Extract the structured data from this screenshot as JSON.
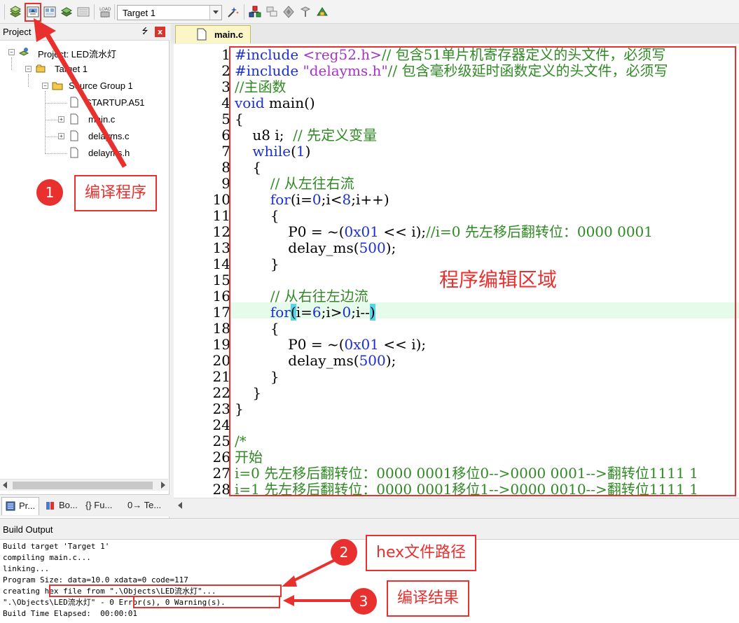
{
  "toolbar": {
    "target_select_value": "Target 1",
    "icons": [
      "translate-icon",
      "build-icon",
      "rebuild-icon",
      "batch-build-icon",
      "stop-build-icon",
      "download-icon",
      "target-options-icon",
      "manage-components-icon",
      "file-extensions-icon",
      "pack-installer-icon",
      "runtime-env-icon",
      "select-packs-icon"
    ]
  },
  "project_panel": {
    "title": "Project",
    "pin_glyph": "⭍",
    "close_glyph": "x",
    "tree": [
      {
        "label": "Project: LED流水灯",
        "level": 0
      },
      {
        "label": "Target 1",
        "level": 1
      },
      {
        "label": "Source Group 1",
        "level": 2
      },
      {
        "label": "STARTUP.A51",
        "level": 3
      },
      {
        "label": "main.c",
        "level": 3
      },
      {
        "label": "delayms.c",
        "level": 3
      },
      {
        "label": "delayms.h",
        "level": 3
      }
    ],
    "tabs": [
      "Pr...",
      "Bo...",
      "{} Fu...",
      "0→ Te..."
    ]
  },
  "editor": {
    "active_tab": "main.c",
    "line_numbers": [
      "1",
      "2",
      "3",
      "4",
      "5",
      "6",
      "7",
      "8",
      "9",
      "10",
      "11",
      "12",
      "13",
      "14",
      "15",
      "16",
      "17",
      "18",
      "19",
      "20",
      "21",
      "22",
      "23",
      "24",
      "25",
      "26",
      "27",
      "28"
    ],
    "lines": {
      "l1": {
        "a": "#include ",
        "b": "<reg52.h>",
        "c": "// 包含51单片机寄存器定义的头文件，必须写"
      },
      "l2": {
        "a": "#include ",
        "b": "\"delayms.h\"",
        "c": "// 包含毫秒级延时函数定义的头文件，必须写"
      },
      "l3": "//主函数",
      "l4": {
        "a": "void",
        "b": " main()"
      },
      "l5": "{",
      "l6": {
        "a": "    u8 i;  ",
        "b": "// 先定义变量"
      },
      "l7": {
        "a": "    while",
        "b": "(",
        "c": "1",
        "d": ")"
      },
      "l8": "    {",
      "l9": "        // 从左往右流",
      "l10": {
        "a": "        for",
        "b": "(i=",
        "c": "0",
        "d": ";i<",
        "e": "8",
        "f": ";i++)"
      },
      "l11": "        {",
      "l12": {
        "a": "            P0 = ~(",
        "b": "0x01",
        "c": " << i);",
        "d": "//i=0 先左移后翻转位：0000 0001"
      },
      "l13": {
        "a": "            delay_ms(",
        "b": "500",
        "c": ");"
      },
      "l14": "        }",
      "l15": "",
      "l16": "        // 从右往左边流",
      "l17": {
        "a": "        for",
        "b": "(",
        "c": "i=",
        "d": "6",
        "e": ";i>",
        "f": "0",
        "g": ";i--",
        "h": ")"
      },
      "l18": "        {",
      "l19": {
        "a": "            P0 = ~(",
        "b": "0x01",
        "c": " << i);"
      },
      "l20": {
        "a": "            delay_ms(",
        "b": "500",
        "c": ");"
      },
      "l21": "        }",
      "l22": "    }",
      "l23": "}",
      "l24": "",
      "l25": "/*",
      "l26": "开始",
      "l27": "i=0 先左移后翻转位：0000 0001移位0-->0000 0001-->翻转位1111 1",
      "l28": "i=1 先左移后翻转位：0000 0001移位1-->0000 0010-->翻转位1111 1"
    }
  },
  "build_output": {
    "title": "Build Output",
    "lines": [
      "Build target 'Target 1'",
      "compiling main.c...",
      "linking...",
      "Program Size: data=10.0 xdata=0 code=117"
    ],
    "line5_prefix": "creating ",
    "line5_boxed": "hex file from \".\\Objects\\LED流水灯\"...",
    "line6_prefix": "\".\\Objects\\LED流水灯\" - ",
    "line6_boxed": "0 Error(s), 0 Warning(s).",
    "line7": "Build Time Elapsed:  00:00:01"
  },
  "annotations": {
    "a1_num": "1",
    "a1_label": "编译程序",
    "a2_num": "2",
    "a2_label": "hex文件路径",
    "a3_num": "3",
    "a3_label": "编译结果",
    "region_label": "程序编辑区域",
    "color": "#e8312f"
  }
}
